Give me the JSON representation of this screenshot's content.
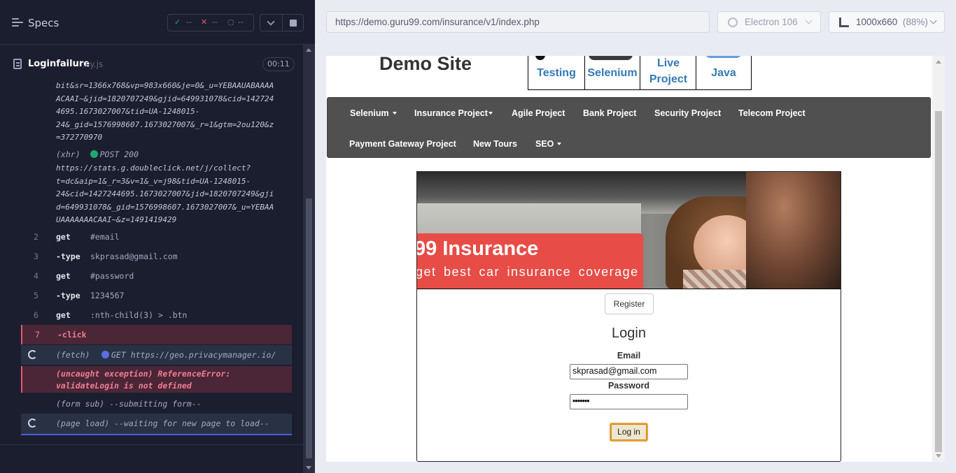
{
  "reporter": {
    "header": {
      "title": "Specs",
      "stats": {
        "passed": "--",
        "failed": "--",
        "pending": "--"
      }
    },
    "spec": {
      "name": "Loginfailure",
      "ext": ".cy.js",
      "duration": "00:11"
    },
    "log": {
      "url_top": "bit&sr=1366x768&vp=983x660&je=0&_u=YEBAAUABAAAA\nACAAI~&jid=1820707249&gjid=649931078&cid=142724\n4695.1673027007&tid=UA-1248015-\n24&_gid=1576998607.1673027007&_r=1&gtm=2ou120&z\n=372770970",
      "xhr_type": "(xhr)",
      "xhr_status": "POST 200",
      "xhr_url": "https://stats.g.doubleclick.net/j/collect?\nt=dc&aip=1&_r=3&v=1&_v=j98&tid=UA-1248015-\n24&cid=1427244695.1673027007&jid=1820707249&gji\nd=649931078&_gid=1576998607.1673027007&_u=YEBAA\nUAAAAAAACAAI~&z=1491419429",
      "commands": [
        {
          "num": "2",
          "name": "get",
          "msg": "#email"
        },
        {
          "num": "3",
          "name": "-type",
          "msg": "skprasad@gmail.com"
        },
        {
          "num": "4",
          "name": "get",
          "msg": "#password"
        },
        {
          "num": "5",
          "name": "-type",
          "msg": "1234567"
        },
        {
          "num": "6",
          "name": "get",
          "msg": ":nth-child(3) > .btn"
        },
        {
          "num": "7",
          "name": "-click",
          "msg": ""
        }
      ],
      "fetch_type": "(fetch)",
      "fetch_text": "GET https://geo.privacymanager.io/",
      "exception_line1": "(uncaught exception)  ReferenceError:",
      "exception_line2": "validateLogin is not defined",
      "form_sub": "(form sub)  --submitting form--",
      "page_load": "(page load)  --waiting for new page to load--"
    }
  },
  "runner": {
    "url": "https://demo.guru99.com/insurance/v1/index.php",
    "browser": "Electron 106",
    "viewport": "1000x660",
    "zoom": "(88%)"
  },
  "site": {
    "title": "Demo Site",
    "top_links": [
      "Testing",
      "Selenium",
      "Live Project",
      "Java"
    ],
    "nav_row1": [
      "Selenium",
      "Insurance Project",
      "Agile Project",
      "Bank Project",
      "Security Project",
      "Telecom Project"
    ],
    "nav_row2": [
      "Payment Gateway Project",
      "New Tours",
      "SEO"
    ],
    "banner_title": "99 Insurance",
    "banner_sub": "get best car insurance coverage",
    "register": "Register",
    "login_heading": "Login",
    "email_label": "Email",
    "email_value": "skprasad@gmail.com",
    "password_label": "Password",
    "password_value": "•••••••",
    "login_button": "Log in"
  },
  "colors": {
    "pass": "#1fa971",
    "fail": "#e45770",
    "accent": "#4c5ddd",
    "nav": "#505050",
    "banner_red": "#e74c46",
    "link": "#337ab7"
  }
}
